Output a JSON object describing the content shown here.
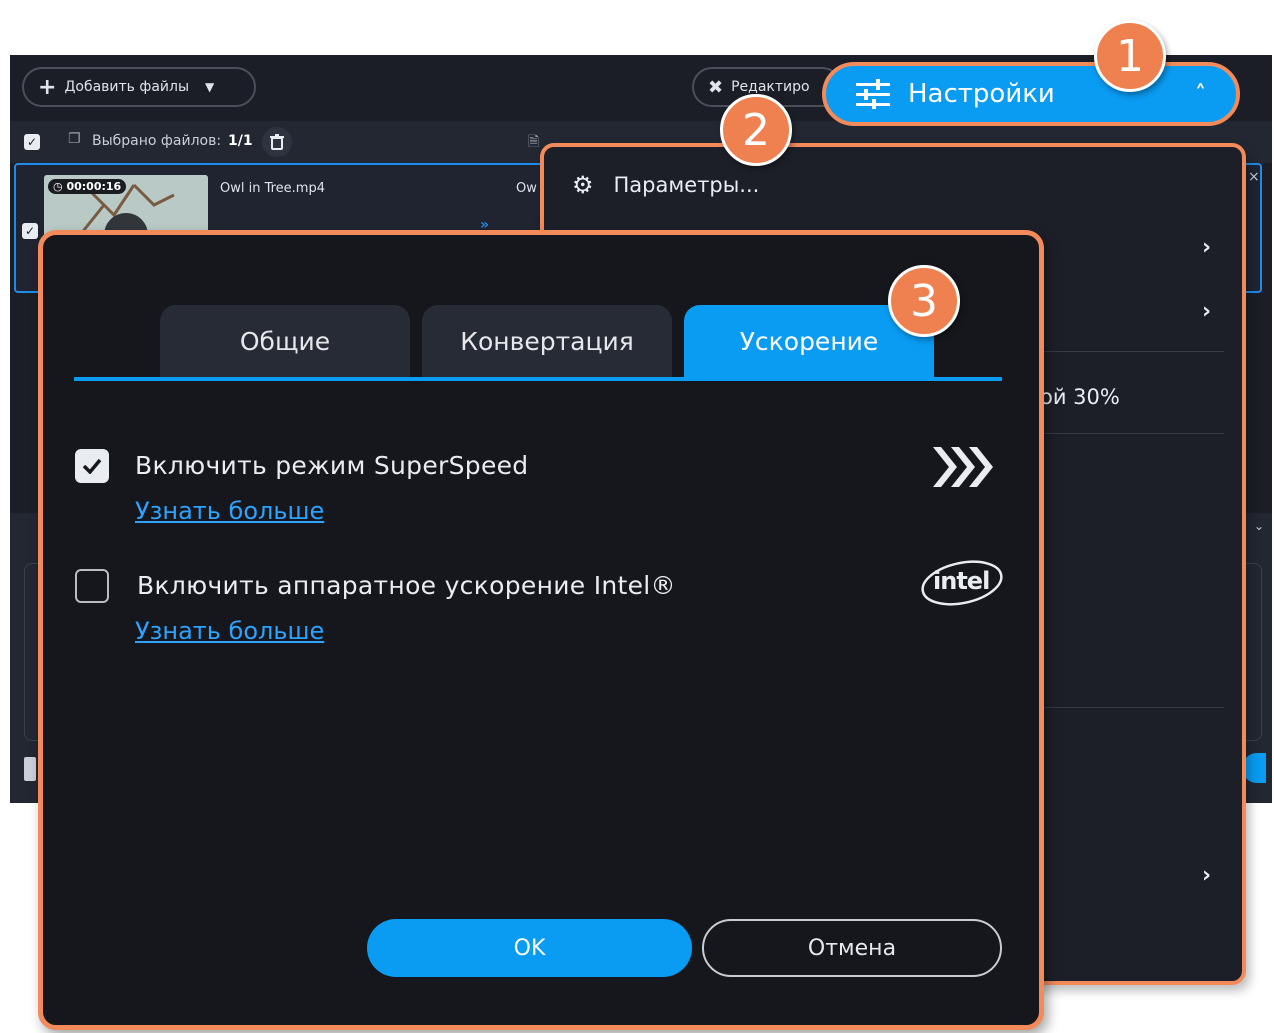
{
  "app": {
    "add_files_label": "Добавить файлы",
    "edit_label": "Редактиро",
    "selected_files_label": "Выбрано файлов:",
    "selected_files_count": "1/1",
    "file": {
      "timecode": "00:00:16",
      "name": "Owl in Tree.mp4",
      "output_name_partial": "Ow"
    }
  },
  "settings_button": {
    "label": "Настройки"
  },
  "menu": {
    "params_label": "Параметры...",
    "partial_text": "ой 30%"
  },
  "dialog": {
    "tabs": [
      {
        "label": "Общие",
        "active": false
      },
      {
        "label": "Конвертация",
        "active": false
      },
      {
        "label": "Ускорение",
        "active": true
      }
    ],
    "options": [
      {
        "label": "Включить режим SuperSpeed",
        "checked": true,
        "link": "Узнать больше",
        "icon": "superspeed-icon"
      },
      {
        "label": "Включить аппаратное ускорение Intel®",
        "checked": false,
        "link": "Узнать больше",
        "icon": "intel-logo"
      }
    ],
    "intel_logo_text": "intel",
    "ok_label": "OK",
    "cancel_label": "Отмена"
  },
  "callouts": [
    "1",
    "2",
    "3"
  ],
  "colors": {
    "accent": "#0a9bf2",
    "callout": "#ef8150",
    "dialog_bg": "#15171d",
    "link": "#2ca3ff"
  }
}
